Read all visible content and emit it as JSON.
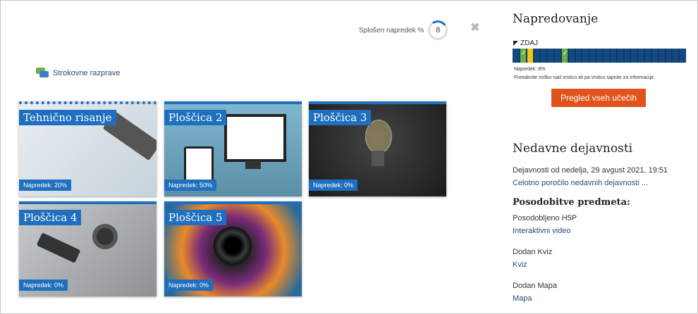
{
  "header": {
    "progress_label": "Splošen napredek %",
    "progress_value": "8",
    "progress_percent": 8,
    "close": "✖"
  },
  "forum": {
    "label": "Strokovne razprave",
    "icon": "forum-icon"
  },
  "tiles": [
    {
      "title": "Tehnično risanje",
      "progress": "Napredek: 20%"
    },
    {
      "title": "Ploščica 2",
      "progress": "Napredek: 50%"
    },
    {
      "title": "Ploščica 3",
      "progress": "Napredek: 0%"
    },
    {
      "title": "Ploščica 4",
      "progress": "Napredek: 0%"
    },
    {
      "title": "Ploščica 5",
      "progress": "Napredek: 0%"
    }
  ],
  "sidebar": {
    "progress_title": "Napredovanje",
    "now_label": "ZDAJ",
    "progress_cells": [
      "todo",
      "done",
      "warn",
      "todo",
      "todo",
      "todo",
      "todo",
      "done",
      "todo",
      "todo",
      "todo",
      "todo",
      "todo",
      "todo",
      "todo",
      "todo",
      "todo",
      "todo",
      "todo",
      "todo",
      "todo",
      "todo",
      "todo",
      "todo",
      "todo"
    ],
    "progress_text": "Napredek: 8%",
    "hint_text": "Pomaknite miško nad vrstico ali pa vrstico tapnite za informacije.",
    "button_label": "Pregled vseh učečih",
    "recent_title": "Nedavne dejavnosti",
    "activity_since": "Dejavnosti od nedelja, 29 avgust 2021, 19:51",
    "full_report": "Celotno poročilo nedavnih dejavnosti ...",
    "updates_title": "Posodobitve predmeta:",
    "updates": [
      {
        "label": "Posodobljeno H5P",
        "link": "Interaktivni video"
      },
      {
        "label": "Dodan Kviz",
        "link": "Kviz"
      },
      {
        "label": "Dodan Mapa",
        "link": "Mapa"
      }
    ],
    "colors": {
      "accent": "#1f6fbf",
      "button": "#e0541b",
      "done": "#6eb043",
      "warn": "#f0c419",
      "todo": "#14497f"
    }
  }
}
